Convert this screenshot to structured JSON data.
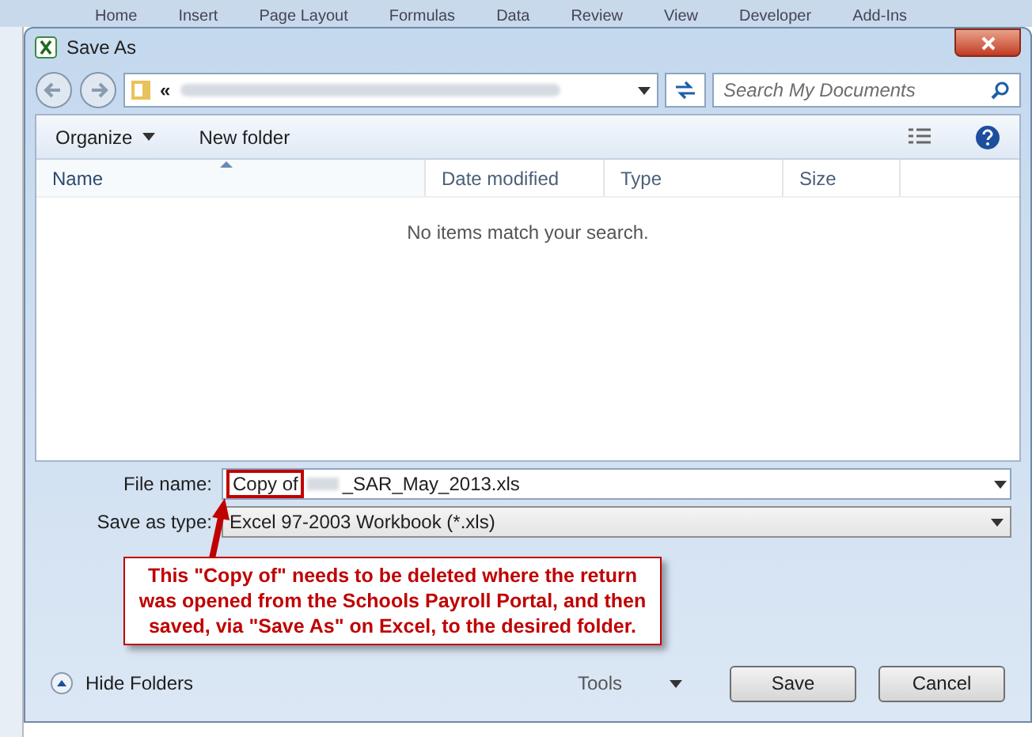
{
  "background_tabs": [
    "Home",
    "Insert",
    "Page Layout",
    "Formulas",
    "Data",
    "Review",
    "View",
    "Developer",
    "Add-Ins"
  ],
  "window": {
    "title": "Save As"
  },
  "address": {
    "prefix": "«"
  },
  "search": {
    "placeholder": "Search My Documents"
  },
  "toolbar": {
    "organize": "Organize",
    "new_folder": "New folder"
  },
  "columns": [
    {
      "label": "Name",
      "sorted": true
    },
    {
      "label": "Date modified",
      "sorted": false
    },
    {
      "label": "Type",
      "sorted": false
    },
    {
      "label": "Size",
      "sorted": false
    }
  ],
  "empty_message": "No items match your search.",
  "file_name": {
    "label": "File name:",
    "highlighted": "Copy of",
    "rest": "_SAR_May_2013.xls"
  },
  "save_type": {
    "label": "Save as type:",
    "value": "Excel 97-2003 Workbook (*.xls)"
  },
  "footer": {
    "hide_folders": "Hide Folders",
    "tools": "Tools",
    "save": "Save",
    "cancel": "Cancel"
  },
  "callout": {
    "text": "This \"Copy of\" needs to be deleted where the return was opened from the Schools Payroll Portal, and then saved, via \"Save As\" on Excel, to the desired folder."
  }
}
